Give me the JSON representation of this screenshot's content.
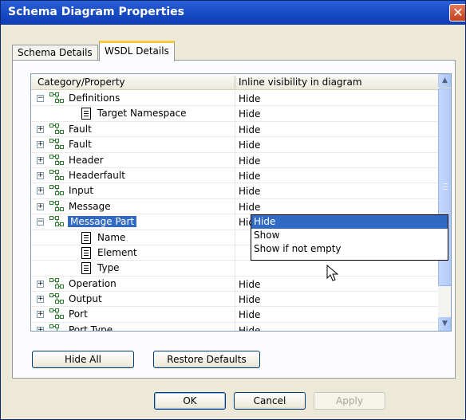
{
  "window": {
    "title": "Schema Diagram Properties",
    "close": "✕"
  },
  "tabs": [
    {
      "label": "Schema Details",
      "active": false
    },
    {
      "label": "WSDL Details",
      "active": true
    }
  ],
  "grid": {
    "columns": [
      "Category/Property",
      "Inline visibility in diagram"
    ],
    "rows": [
      {
        "name": "Definitions",
        "value": "Hide",
        "type": "node",
        "expander": "−",
        "level": 0
      },
      {
        "name": "Target Namespace",
        "value": "Hide",
        "type": "leaf",
        "level": 1
      },
      {
        "name": "Fault",
        "value": "Hide",
        "type": "node",
        "expander": "+",
        "level": 0
      },
      {
        "name": "Fault",
        "value": "Hide",
        "type": "node",
        "expander": "+",
        "level": 0
      },
      {
        "name": "Header",
        "value": "Hide",
        "type": "node",
        "expander": "+",
        "level": 0
      },
      {
        "name": "Headerfault",
        "value": "Hide",
        "type": "node",
        "expander": "+",
        "level": 0
      },
      {
        "name": "Input",
        "value": "Hide",
        "type": "node",
        "expander": "+",
        "level": 0
      },
      {
        "name": "Message",
        "value": "Hide",
        "type": "node",
        "expander": "+",
        "level": 0
      },
      {
        "name": "Message Part",
        "value": "Hide",
        "type": "node",
        "expander": "−",
        "level": 0,
        "selected": true
      },
      {
        "name": "Name",
        "value": "",
        "type": "leaf",
        "level": 1
      },
      {
        "name": "Element",
        "value": "",
        "type": "leaf",
        "level": 1
      },
      {
        "name": "Type",
        "value": "",
        "type": "leaf",
        "level": 1
      },
      {
        "name": "Operation",
        "value": "Hide",
        "type": "node",
        "expander": "+",
        "level": 0
      },
      {
        "name": "Output",
        "value": "Hide",
        "type": "node",
        "expander": "+",
        "level": 0
      },
      {
        "name": "Port",
        "value": "Hide",
        "type": "node",
        "expander": "+",
        "level": 0
      },
      {
        "name": "Port Type",
        "value": "Hide",
        "type": "node",
        "expander": "+",
        "level": 0
      }
    ],
    "dropdown": {
      "options": [
        "Hide",
        "Show",
        "Show if not empty"
      ],
      "selected": "Hide",
      "arrow": "▼"
    },
    "scroll": {
      "up": "▲",
      "down": "▼"
    }
  },
  "buttons": {
    "hide_all": "Hide All",
    "restore_defaults": "Restore Defaults",
    "ok": "OK",
    "cancel": "Cancel",
    "apply": "Apply"
  },
  "colors": {
    "selection": "#316ac5",
    "titlebar": "#1a4fc7",
    "active_tab_accent": "#ffc83c"
  }
}
